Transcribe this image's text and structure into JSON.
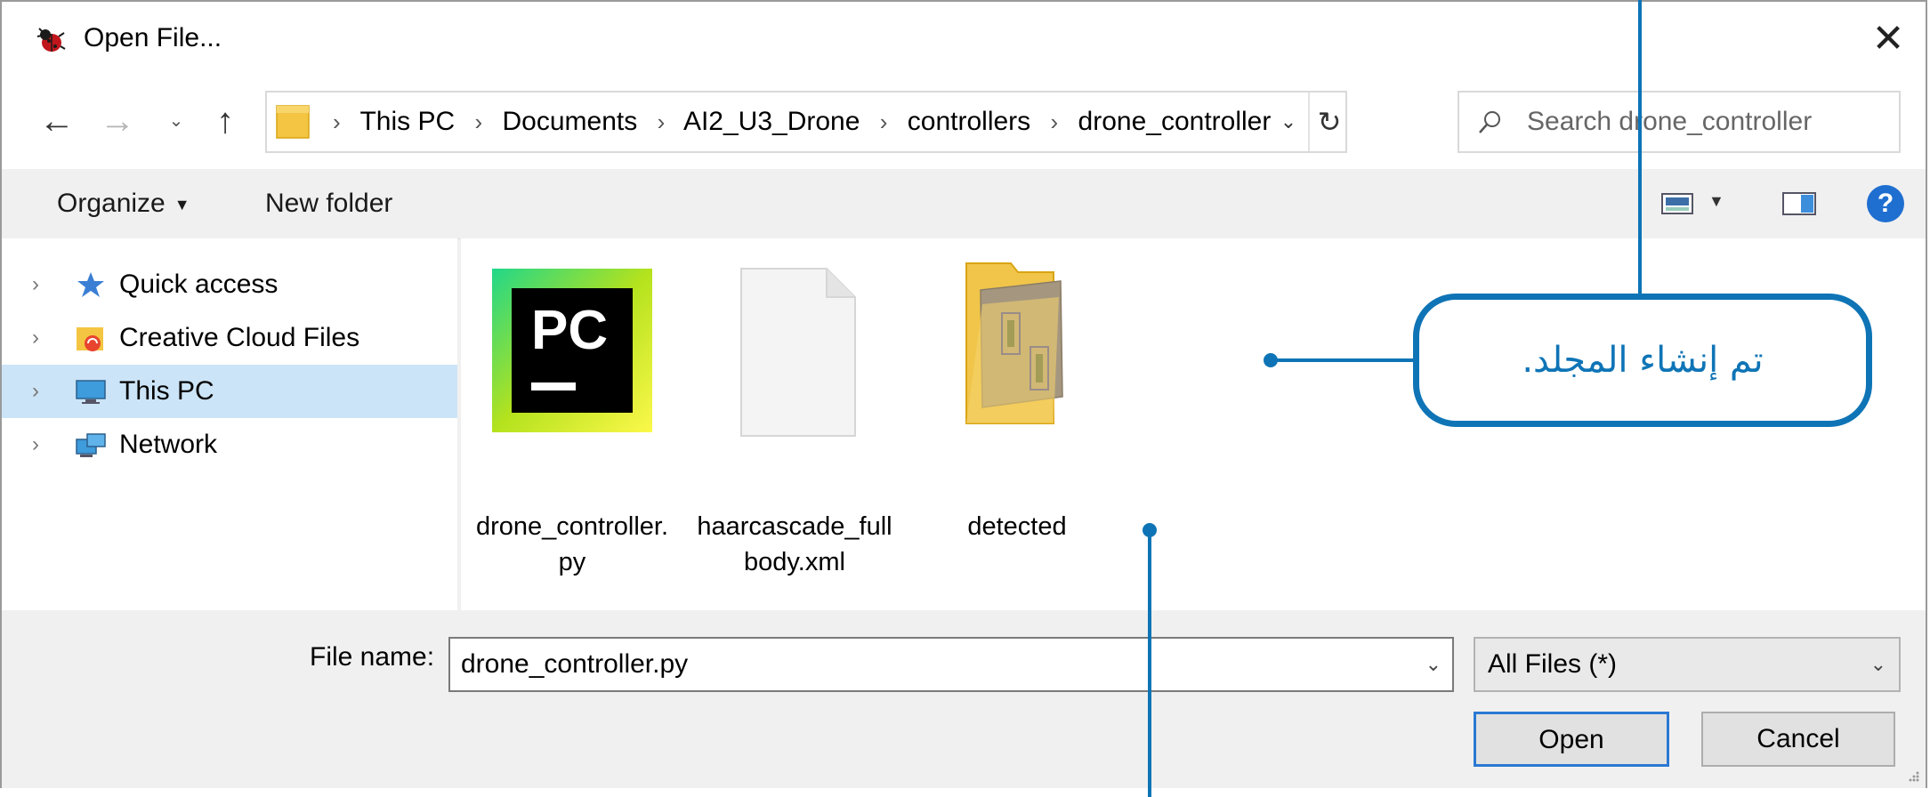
{
  "window": {
    "title": "Open File...",
    "close_glyph": "✕",
    "icon": "bug-app-icon"
  },
  "nav_buttons": {
    "back": "←",
    "forward": "→",
    "recent": "⌄",
    "up": "↑"
  },
  "address": {
    "breadcrumbs": [
      "This PC",
      "Documents",
      "AI2_U3_Drone",
      "controllers",
      "drone_controller"
    ],
    "leading_separator": "›",
    "separator": "›",
    "dropdown_glyph": "⌄",
    "refresh_glyph": "↻"
  },
  "search": {
    "placeholder": "Search drone_controller"
  },
  "command_bar": {
    "organize_label": "Organize",
    "organize_caret": "▼",
    "new_folder_label": "New folder",
    "view_caret": "▼",
    "help_glyph": "?"
  },
  "nav_pane": {
    "items": [
      {
        "label": "Quick access",
        "icon": "star-icon",
        "chevron": "›"
      },
      {
        "label": "Creative Cloud Files",
        "icon": "creative-cloud-folder-icon",
        "chevron": "›"
      },
      {
        "label": "This PC",
        "icon": "computer-icon",
        "chevron": "›",
        "selected": true
      },
      {
        "label": "Network",
        "icon": "network-icon",
        "chevron": "›"
      }
    ]
  },
  "files": [
    {
      "label_line1": "drone_controller.",
      "label_line2": "py",
      "icon": "pycharm-file-icon",
      "icon_text": "PC"
    },
    {
      "label_line1": "haarcascade_full",
      "label_line2": "body.xml",
      "icon": "blank-document-icon"
    },
    {
      "label_line1": "detected",
      "label_line2": "",
      "icon": "folder-with-images-icon"
    }
  ],
  "bottom": {
    "file_name_label": "File name:",
    "file_name_value": "drone_controller.py",
    "file_name_dropdown": "⌄",
    "file_type_value": "All Files (*)",
    "file_type_dropdown": "⌄",
    "open_label": "Open",
    "cancel_label": "Cancel"
  },
  "annotation": {
    "callout_text": "تم إنشاء المجلد.",
    "color": "#0e74b6"
  },
  "colors": {
    "selection": "#cce4f7",
    "accent": "#2a79d3",
    "help": "#1f6fd1"
  }
}
